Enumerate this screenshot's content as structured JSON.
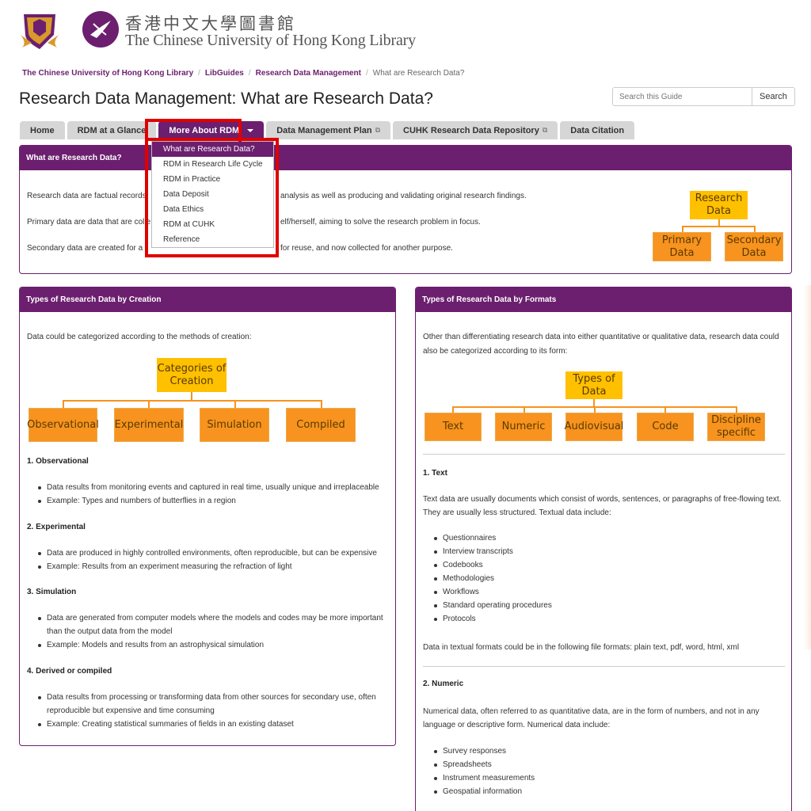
{
  "header": {
    "library_cn": "香港中文大學圖書館",
    "library_en": "The Chinese University of Hong Kong Library"
  },
  "breadcrumb": {
    "items": [
      "The Chinese University of Hong Kong Library",
      "LibGuides",
      "Research Data Management"
    ],
    "current": "What are Research Data?"
  },
  "page_title": "Research Data Management: What are Research Data?",
  "search": {
    "placeholder": "Search this Guide",
    "button": "Search"
  },
  "tabs": [
    {
      "label": "Home"
    },
    {
      "label": "RDM at a Glance"
    },
    {
      "label": "More About RDM"
    },
    {
      "label": "Data Management Plan"
    },
    {
      "label": "CUHK Research Data Repository"
    },
    {
      "label": "Data Citation"
    }
  ],
  "dropdown": {
    "items": [
      "What are Research Data?",
      "RDM in Research Life Cycle",
      "RDM in Practice",
      "Data Deposit",
      "Data Ethics",
      "RDM at CUHK",
      "Reference"
    ]
  },
  "box_what": {
    "title": "What are Research Data?",
    "p1_a": "Research data are factual records",
    "p1_b": "analysis as well as producing and validating original research findings.",
    "p2_a": "Primary data are data that are colle",
    "p2_b": "elf/herself, aiming to solve the research problem in focus.",
    "p3_a": "Secondary data are created for a",
    "p3_b": "for reuse, and now collected for another purpose.",
    "diagram": {
      "root": "Research Data",
      "children": [
        "Primary Data",
        "Secondary Data"
      ]
    }
  },
  "box_creation": {
    "title": "Types of Research Data by Creation",
    "intro": "Data could be categorized according to the methods of creation:",
    "diagram": {
      "root": "Categories of Creation",
      "children": [
        "Observational",
        "Experimental",
        "Simulation",
        "Compiled"
      ]
    },
    "s1": {
      "heading": "1. Observational",
      "bullets": [
        "Data results from monitoring events and captured in real time, usually unique and irreplaceable",
        "Example: Types and numbers of butterflies in a region"
      ]
    },
    "s2": {
      "heading": "2. Experimental",
      "bullets": [
        "Data are produced in highly controlled environments, often reproducible, but can be expensive",
        "Example: Results from an experiment measuring the refraction of light"
      ]
    },
    "s3": {
      "heading": "3. Simulation",
      "bullet1_l1": "Data are generated from computer models where the models and codes may be more important",
      "bullet1_l2": "than the output data from the model",
      "bullet2": "Example: Models and results from an astrophysical simulation"
    },
    "s4": {
      "heading": "4. Derived or compiled",
      "bullet1_l1": "Data results from processing or transforming data from other sources for secondary use, often",
      "bullet1_l2": "reproducible but expensive and time consuming",
      "bullet2": "Example: Creating statistical summaries of fields in an existing dataset"
    }
  },
  "box_formats": {
    "title": "Types of Research Data by Formats",
    "intro_l1": "Other than differentiating research data into either quantitative or qualitative data, research data could",
    "intro_l2": "also be categorized according to its form:",
    "diagram": {
      "root": "Types of Data",
      "children": [
        "Text",
        "Numeric",
        "Audiovisual",
        "Code",
        "Discipline specific"
      ]
    },
    "text": {
      "heading": "1. Text",
      "desc_l1": "Text data are usually documents which consist of words, sentences, or paragraphs of free-flowing text.",
      "desc_l2": "They are usually less structured. Textual data include:",
      "bullets": [
        "Questionnaires",
        "Interview transcripts",
        "Codebooks",
        "Methodologies",
        "Workflows",
        "Standard operating procedures",
        "Protocols"
      ],
      "formats": "Data in textual formats could be in the following file formats: plain text, pdf, word, html, xml"
    },
    "numeric": {
      "heading": "2. Numeric",
      "desc_l1": "Numerical data, often referred to as quantitative data, are in the form of numbers, and not in any",
      "desc_l2": "language or descriptive form. Numerical data include:",
      "bullets": [
        "Survey responses",
        "Spreadsheets",
        "Instrument measurements",
        "Geospatial information"
      ]
    }
  },
  "colors": {
    "brand": "#6b1f6e",
    "gold": "#ffc000",
    "orange": "#f7931e",
    "highlight": "#e00000"
  }
}
